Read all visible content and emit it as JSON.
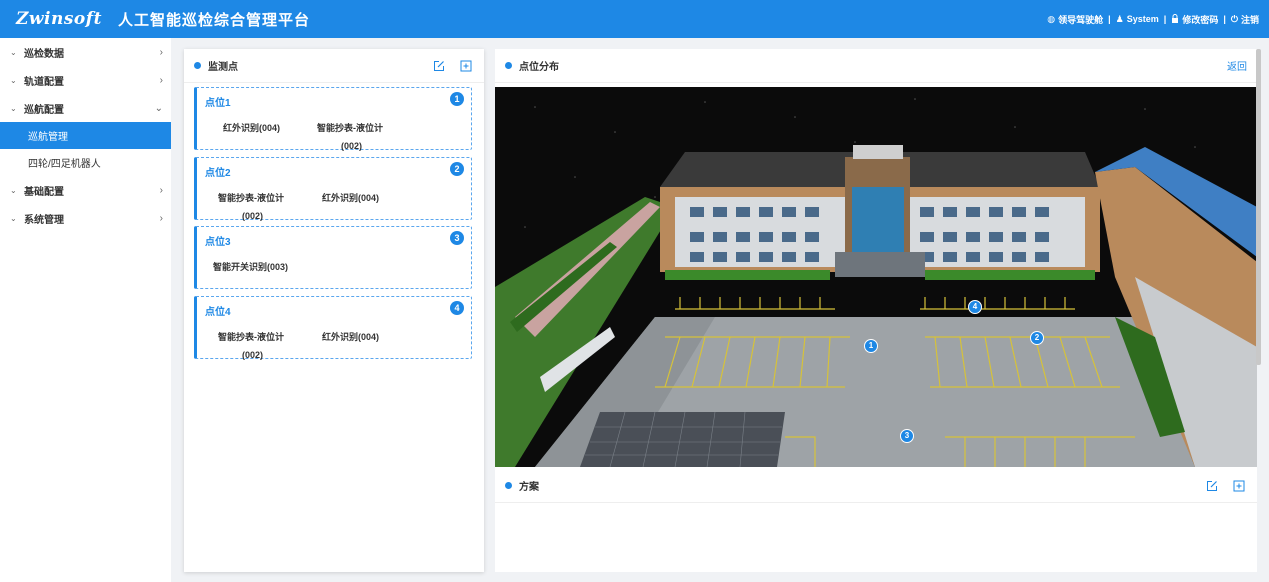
{
  "header": {
    "logo": "Zwinsoft",
    "title": "人工智能巡检综合管理平台",
    "links": [
      "领导驾驶舱",
      "System",
      "修改密码",
      "注销"
    ],
    "separator": "|"
  },
  "sidebar": {
    "items": [
      {
        "label": "巡检数据",
        "caret": "⌄",
        "arrow": "›"
      },
      {
        "label": "轨道配置",
        "caret": "⌄",
        "arrow": "›"
      },
      {
        "label": "巡航配置",
        "caret": "⌄",
        "arrow": "⌄"
      },
      {
        "label": "基础配置",
        "caret": "⌄",
        "arrow": "›"
      },
      {
        "label": "系统管理",
        "caret": "⌄",
        "arrow": "›"
      }
    ],
    "subitems": [
      {
        "label": "巡航管理",
        "active": true
      },
      {
        "label": "四轮/四足机器人",
        "active": false
      }
    ]
  },
  "left_panel": {
    "title": "监测点",
    "points": [
      {
        "name": "点位1",
        "badge": "1",
        "tags": [
          "红外识别(004)",
          "智能抄表-液位计",
          "(002)"
        ]
      },
      {
        "name": "点位2",
        "badge": "2",
        "tags": [
          "智能抄表-液位计",
          "红外识别(004)",
          "(002)"
        ]
      },
      {
        "name": "点位3",
        "badge": "3",
        "tags": [
          "智能开关识别(003)"
        ]
      },
      {
        "name": "点位4",
        "badge": "4",
        "tags": [
          "智能抄表-液位计",
          "红外识别(004)",
          "(002)"
        ]
      }
    ]
  },
  "right_panel": {
    "title": "点位分布",
    "back": "返回",
    "markers": [
      "1",
      "2",
      "3",
      "4"
    ],
    "scheme_title": "方案"
  },
  "colors": {
    "accent": "#1e88e5",
    "header": "#1e88e5"
  }
}
